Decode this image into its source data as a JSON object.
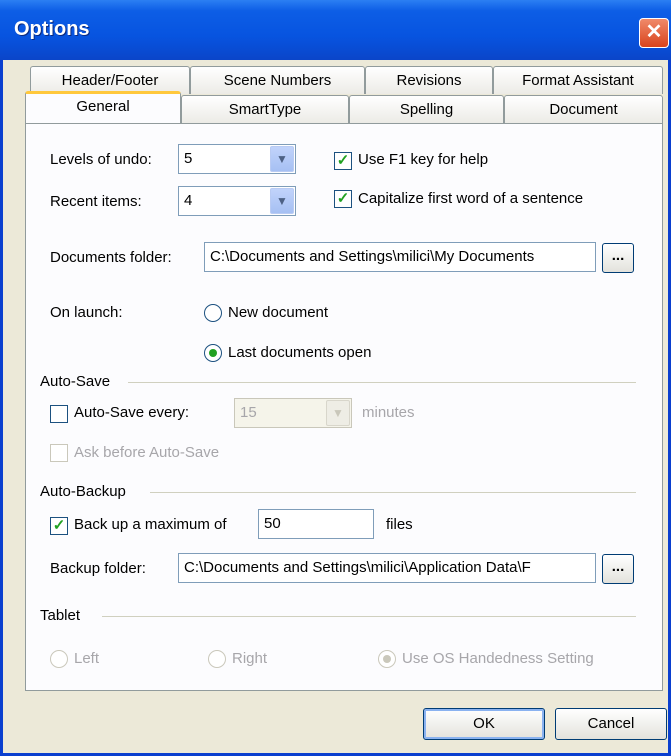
{
  "window": {
    "title": "Options",
    "close_glyph": "✕"
  },
  "tabs": {
    "row1": [
      "Header/Footer",
      "Scene Numbers",
      "Revisions",
      "Format Assistant"
    ],
    "row2": [
      "General",
      "SmartType",
      "Spelling",
      "Document"
    ],
    "active": "General"
  },
  "general": {
    "levels_of_undo": {
      "label": "Levels of undo:",
      "value": "5"
    },
    "recent_items": {
      "label": "Recent items:",
      "value": "4"
    },
    "use_f1": {
      "label": "Use F1 key for help",
      "checked": true
    },
    "capitalize": {
      "label": "Capitalize first word of a sentence",
      "checked": true
    },
    "documents_folder": {
      "label": "Documents folder:",
      "value": "C:\\Documents and Settings\\milici\\My Documents"
    },
    "browse_label": "...",
    "on_launch": {
      "label": "On launch:",
      "options": [
        "New document",
        "Last documents open"
      ],
      "selected": "Last documents open"
    }
  },
  "autosave": {
    "heading": "Auto-Save",
    "every_label": "Auto-Save every:",
    "interval": "15",
    "unit": "minutes",
    "ask_label": "Ask before Auto-Save"
  },
  "autobackup": {
    "heading": "Auto-Backup",
    "backup_label": "Back up a maximum of",
    "max_files": "50",
    "unit": "files",
    "folder_label": "Backup folder:",
    "folder_value": "C:\\Documents and Settings\\milici\\Application Data\\F"
  },
  "tablet": {
    "heading": "Tablet",
    "options": [
      "Left",
      "Right",
      "Use OS Handedness Setting"
    ],
    "selected": "Use OS Handedness Setting"
  },
  "buttons": {
    "ok": "OK",
    "cancel": "Cancel"
  },
  "colors": {
    "titlebar": "#0754e0",
    "dialog_bg": "#ece9d8",
    "check_green": "#21a121",
    "tab_highlight": "#ffc83c"
  },
  "icons": {
    "dropdown": "chevron-down-icon",
    "close": "close-icon",
    "check": "checkmark-icon"
  }
}
